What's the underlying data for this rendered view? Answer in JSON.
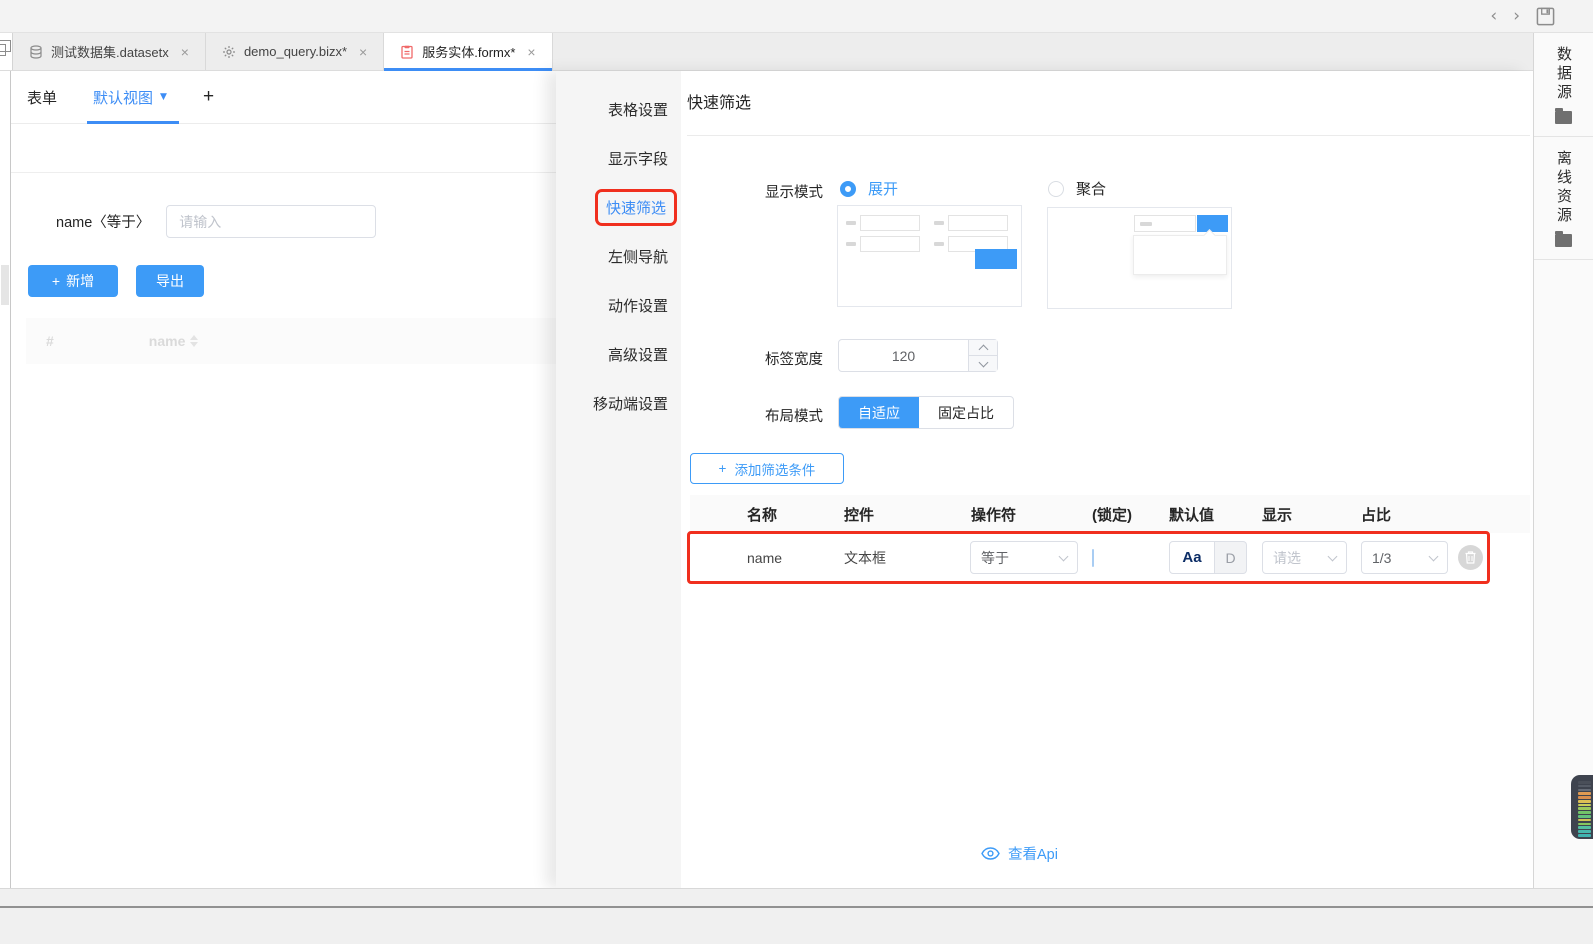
{
  "window": {
    "nav_back": "‹",
    "nav_forward": "›"
  },
  "tabs": [
    {
      "icon": "database-icon",
      "label": "测试数据集.datasetx",
      "close": "×"
    },
    {
      "icon": "gear-icon",
      "label": "demo_query.bizx*",
      "close": "×"
    },
    {
      "icon": "form-file-icon",
      "label": "服务实体.formx*",
      "close": "×"
    }
  ],
  "view_toolbar": {
    "form_tab": "表单",
    "active_view": "默认视图",
    "add_view": "+"
  },
  "canvas": {
    "filter_label": "name〈等于〉",
    "filter_placeholder": "请输入",
    "add_button": "新增",
    "add_plus": "+",
    "export_button": "导出",
    "table_headers": [
      "#",
      "name"
    ]
  },
  "panel": {
    "menu": [
      "表格设置",
      "显示字段",
      "快速筛选",
      "左侧导航",
      "动作设置",
      "高级设置",
      "移动端设置"
    ],
    "active_menu": "快速筛选",
    "title": "快速筛选",
    "display_mode": {
      "label": "显示模式",
      "options": [
        {
          "label": "展开",
          "selected": true
        },
        {
          "label": "聚合",
          "selected": false
        }
      ]
    },
    "label_width": {
      "label": "标签宽度",
      "value": "120"
    },
    "layout_mode": {
      "label": "布局模式",
      "options": [
        {
          "label": "自适应",
          "selected": true
        },
        {
          "label": "固定占比",
          "selected": false
        }
      ]
    },
    "add_condition": "添加筛选条件",
    "add_condition_plus": "+",
    "filter_table": {
      "headers": [
        "名称",
        "控件",
        "操作符",
        "(锁定)",
        "默认值",
        "显示",
        "占比"
      ],
      "row": {
        "name": "name",
        "control": "文本框",
        "operator": "等于",
        "default_style_label": "Aa",
        "default_d_label": "D",
        "display_placeholder": "请选",
        "ratio": "1/3"
      }
    },
    "view_api": "查看Api"
  },
  "dock": {
    "items": [
      {
        "label": "数据源"
      },
      {
        "label": "离线资源"
      }
    ]
  },
  "colors": {
    "primary": "#3d9bf7",
    "annotation": "#f02f1e",
    "tab_active_underline": "#3d8df5"
  }
}
